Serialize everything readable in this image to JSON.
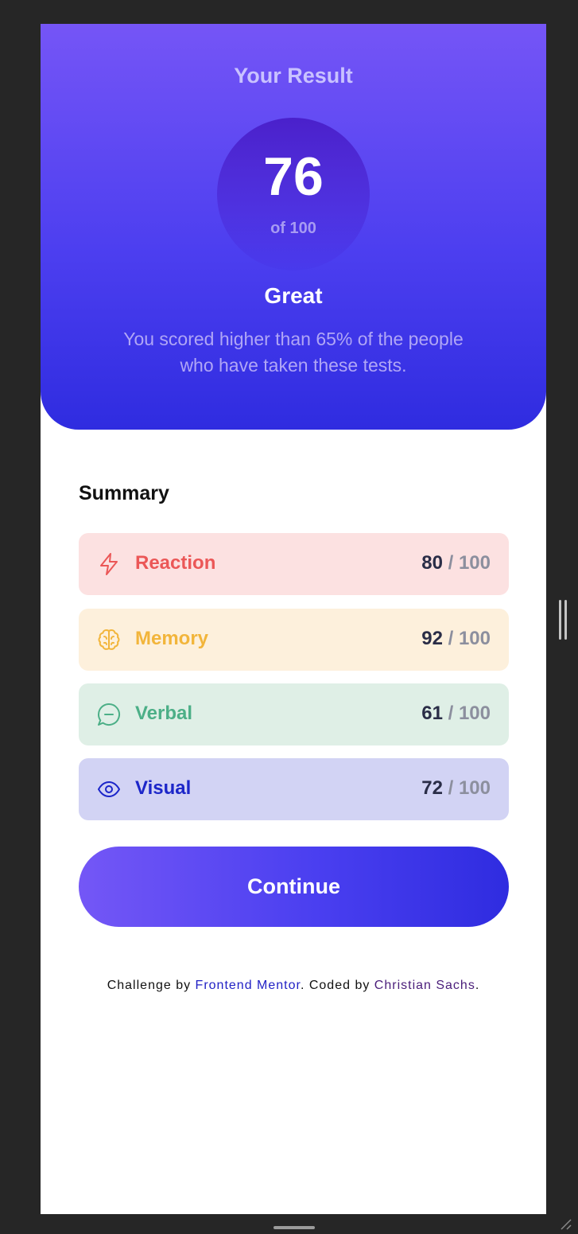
{
  "result": {
    "heading": "Your Result",
    "score": "76",
    "score_total": "of 100",
    "rating": "Great",
    "description": "You scored higher than 65% of the people who have taken these tests."
  },
  "summary": {
    "heading": "Summary",
    "items": [
      {
        "label": "Reaction",
        "score": "80",
        "separator": "/",
        "max": "100",
        "icon": "lightning-icon",
        "color": "#eb5757",
        "background": "#fce1e1"
      },
      {
        "label": "Memory",
        "score": "92",
        "separator": "/",
        "max": "100",
        "icon": "brain-icon",
        "color": "#f2b53b",
        "background": "#fdf0dc"
      },
      {
        "label": "Verbal",
        "score": "61",
        "separator": "/",
        "max": "100",
        "icon": "chat-bubble-icon",
        "color": "#4caf87",
        "background": "#dfefe6"
      },
      {
        "label": "Visual",
        "score": "72",
        "separator": "/",
        "max": "100",
        "icon": "eye-icon",
        "color": "#1c26c9",
        "background": "#d2d3f4"
      }
    ]
  },
  "continue_label": "Continue",
  "footer": {
    "prefix": "Challenge by ",
    "link1": "Frontend Mentor",
    "middle": ". Coded by ",
    "link2": "Christian Sachs",
    "suffix": "."
  },
  "colors": {
    "gradient_start": "#7555f6",
    "gradient_end": "#2f2ce0",
    "score_text": "#2a2d47",
    "muted_text": "#8c8f9e"
  }
}
